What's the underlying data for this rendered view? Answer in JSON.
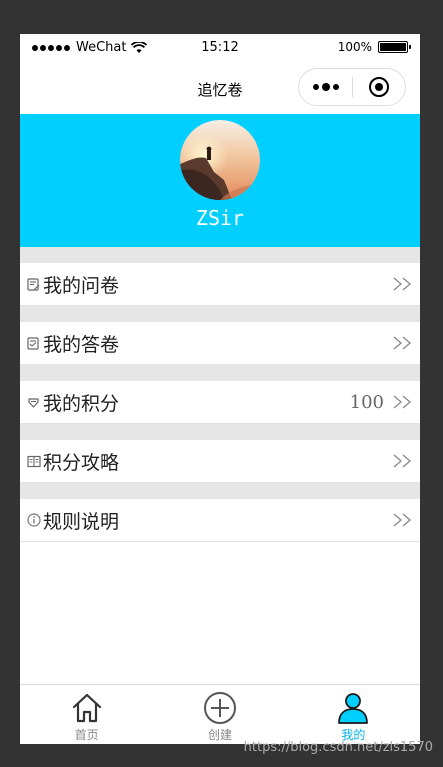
{
  "status_bar": {
    "carrier": "WeChat",
    "time": "15:12",
    "battery": "100%",
    "battery_level": 1.0
  },
  "nav": {
    "title": "追忆卷"
  },
  "profile": {
    "username": "ZSir"
  },
  "menu": [
    {
      "label": "我的问卷",
      "icon": "survey-icon",
      "value": ""
    },
    {
      "label": "我的答卷",
      "icon": "answer-sheet-icon",
      "value": ""
    },
    {
      "label": "我的积分",
      "icon": "points-icon",
      "value": "100"
    },
    {
      "label": "积分攻略",
      "icon": "guide-book-icon",
      "value": ""
    },
    {
      "label": "规则说明",
      "icon": "info-icon",
      "value": ""
    }
  ],
  "tabs": [
    {
      "label": "首页",
      "icon": "home-icon",
      "active": false
    },
    {
      "label": "创建",
      "icon": "add-circle-icon",
      "active": false
    },
    {
      "label": "我的",
      "icon": "profile-icon",
      "active": true
    }
  ],
  "watermark": "https://blog.csdn.net/zls1570",
  "colors": {
    "header_bg": "#00cfff",
    "active_tab": "#00b3e6",
    "section_gap": "#e6e6e6",
    "outer_bg": "#333333"
  }
}
